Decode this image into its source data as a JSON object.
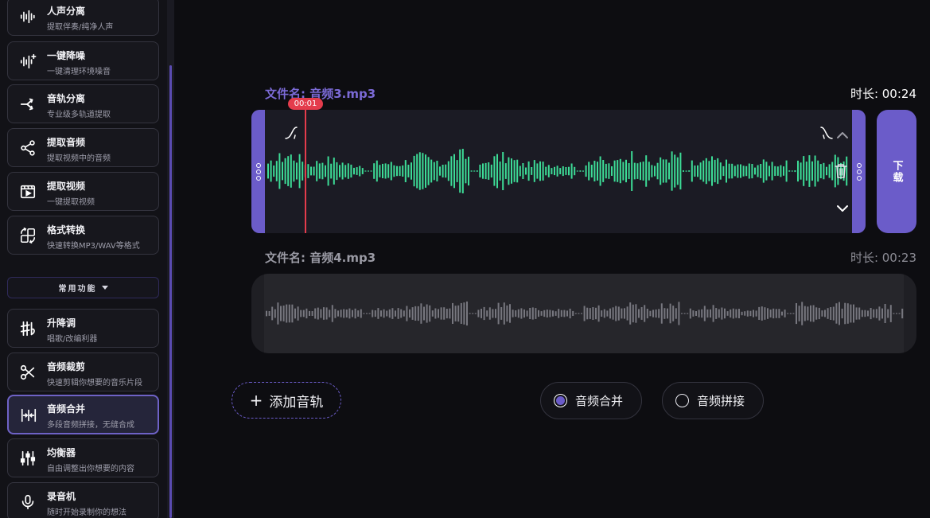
{
  "sidebar": {
    "tools_top": [
      {
        "title": "人声分离",
        "subtitle": "提取伴奏/纯净人声",
        "icon": "waveform-icon"
      },
      {
        "title": "一键降噪",
        "subtitle": "一键清理环境噪音",
        "icon": "sparkle-wave-icon"
      },
      {
        "title": "音轨分离",
        "subtitle": "专业级多轨道提取",
        "icon": "split-icon"
      },
      {
        "title": "提取音频",
        "subtitle": "提取视频中的音频",
        "icon": "share-nodes-icon"
      },
      {
        "title": "提取视频",
        "subtitle": "一键提取视频",
        "icon": "video-icon"
      },
      {
        "title": "格式转换",
        "subtitle": "快速转换MP3/WAV等格式",
        "icon": "convert-icon"
      }
    ],
    "section_label": "常用功能",
    "tools_common": [
      {
        "title": "升降调",
        "subtitle": "唱歌/改编利器",
        "icon": "sharp-flat-icon"
      },
      {
        "title": "音频裁剪",
        "subtitle": "快速剪辑你想要的音乐片段",
        "icon": "scissors-icon"
      },
      {
        "title": "音频合并",
        "subtitle": "多段音频拼接，无缝合成",
        "icon": "merge-icon",
        "active": true
      },
      {
        "title": "均衡器",
        "subtitle": "自由调整出你想要的内容",
        "icon": "equalizer-icon"
      },
      {
        "title": "录音机",
        "subtitle": "随时开始录制你的想法",
        "icon": "microphone-icon"
      }
    ]
  },
  "tracks": [
    {
      "filename": "文件名: 音频3.mp3",
      "duration": "时长: 00:24",
      "active": true
    },
    {
      "filename": "文件名: 音频4.mp3",
      "duration": "时长: 00:23",
      "active": false
    }
  ],
  "playhead": {
    "time": "00:01"
  },
  "download_label": "下载",
  "add_track_label": "添加音轨",
  "modes": [
    {
      "label": "音频合并",
      "selected": true
    },
    {
      "label": "音频拼接",
      "selected": false
    }
  ],
  "colors": {
    "accent": "#6b5cc9",
    "wave_active": "#3ddc97",
    "wave_inactive": "#77777f",
    "playhead": "#e43c4c",
    "label_active": "#7b6ad6",
    "label_inactive": "#9a9aa4"
  }
}
